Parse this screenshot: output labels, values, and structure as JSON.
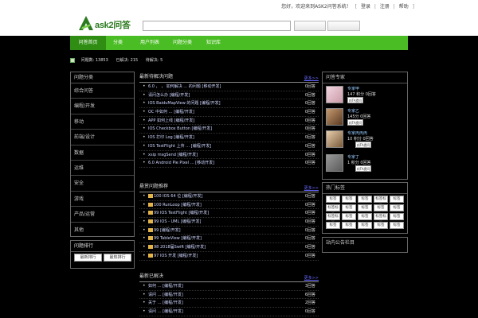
{
  "topbar": {
    "welcome": "您好，欢迎来到ASK2问答系统！",
    "links": [
      "登录",
      "注册",
      "帮助"
    ]
  },
  "header": {
    "logo_text": "ask2问答",
    "search_placeholder": "",
    "btn_ask": "",
    "btn_search": ""
  },
  "nav": {
    "items": [
      "问答首页",
      "分类",
      "用户列表",
      "问题分类",
      "知识库"
    ]
  },
  "stats": {
    "items": [
      "问题数: 13853",
      "已解决: 215",
      "待解决: 5"
    ]
  },
  "left": {
    "title": "问题分类",
    "categories": [
      "综合问答",
      "编程/开发",
      "移动",
      "前端/设计",
      "数据",
      "运维",
      "安全",
      "游戏",
      "产品/运营",
      "其他"
    ],
    "box2_title": "问题排行",
    "box2_tabs": [
      "最新排行",
      "最热排行"
    ]
  },
  "sections": [
    {
      "title": "最新待解决问题",
      "more": "更多>>",
      "rows": [
        {
          "tag": false,
          "text": "6.0 ， ， 如何解决 … 的问题 [移动开发]",
          "count": "0回答"
        },
        {
          "tag": false,
          "text": "请问怎么办 [编程/开发]",
          "count": "0回答"
        },
        {
          "tag": false,
          "text": "IOS BaiduMapView 的问题 [编程/开发]",
          "count": "0回答"
        },
        {
          "tag": false,
          "text": "OC 中如何 … [编程/开发]",
          "count": "0回答"
        },
        {
          "tag": false,
          "text": "APP 如何上线 [编程/开发]",
          "count": "0回答"
        },
        {
          "tag": false,
          "text": "IOS Checkbox Button [编程/开发]",
          "count": "0回答"
        },
        {
          "tag": false,
          "text": "IOS 打印 Log [编程/开发]",
          "count": "0回答"
        },
        {
          "tag": false,
          "text": "IOS TestFlight 上传 … [编程/开发]",
          "count": "0回答"
        },
        {
          "tag": false,
          "text": "xsip msgSend [编程/开发]",
          "count": "0回答"
        },
        {
          "tag": false,
          "text": "6.0 Android Pie Pixel … [移动开发]",
          "count": "0回答"
        }
      ]
    },
    {
      "title": "悬赏问题推荐",
      "more": "更多>>",
      "rows": [
        {
          "tag": true,
          "text": "100 IOS 64 位 [编程/开发]",
          "count": "0回答"
        },
        {
          "tag": true,
          "text": "100 RunLoop [编程/开发]",
          "count": "0回答"
        },
        {
          "tag": true,
          "text": "99 IOS TestFlight [编程/开发]",
          "count": "0回答"
        },
        {
          "tag": true,
          "text": "99 IOS - UML [编程/开发]",
          "count": "0回答"
        },
        {
          "tag": true,
          "text": "99 [编程/开发]",
          "count": "0回答"
        },
        {
          "tag": true,
          "text": "99 TableView [编程/开发]",
          "count": "0回答"
        },
        {
          "tag": true,
          "text": "98 2018届Swift [编程/开发]",
          "count": "0回答"
        },
        {
          "tag": true,
          "text": "97 IOS 开发 [编程/开发]",
          "count": "0回答"
        }
      ]
    },
    {
      "title": "最新已解决",
      "more": "更多>>",
      "rows": [
        {
          "tag": false,
          "text": "如何 … [编程/开发]",
          "count": "3回答"
        },
        {
          "tag": false,
          "text": "请问 … [编程/开发]",
          "count": "6回答"
        },
        {
          "tag": false,
          "text": "关于 … [编程/开发]",
          "count": "2回答"
        },
        {
          "tag": false,
          "text": "请问 … [编程/开发]",
          "count": "0回答"
        }
      ]
    }
  ],
  "right": {
    "experts_title": "问答专家",
    "experts": [
      {
        "name": "专家甲",
        "meta": "147 积分 0回答",
        "ask": "向TA提问"
      },
      {
        "name": "专家乙",
        "meta": "145分 0回答",
        "ask": "向TA提问"
      },
      {
        "name": "专家丙丙丙",
        "meta": "10 积分 0回答",
        "ask": "向TA提问"
      },
      {
        "name": "专家丁",
        "meta": "1 积分 0回答",
        "ask": "向TA提问"
      }
    ],
    "tags_title": "热门标签",
    "tags": [
      "标签",
      "标签",
      "标签",
      "标签标签",
      "标签",
      "标签标签",
      "标签",
      "标签",
      "标签",
      "标签",
      "标签标签",
      "标签",
      "标签",
      "标签标签",
      "标签",
      "标签",
      "标签",
      "标签",
      "标签",
      "标签"
    ],
    "box3_title": "站内公告栏目"
  },
  "colors": {
    "nav_green": "#4bbd24",
    "nav_active": "#2e8d12",
    "logo_green": "#2a7a1e"
  }
}
